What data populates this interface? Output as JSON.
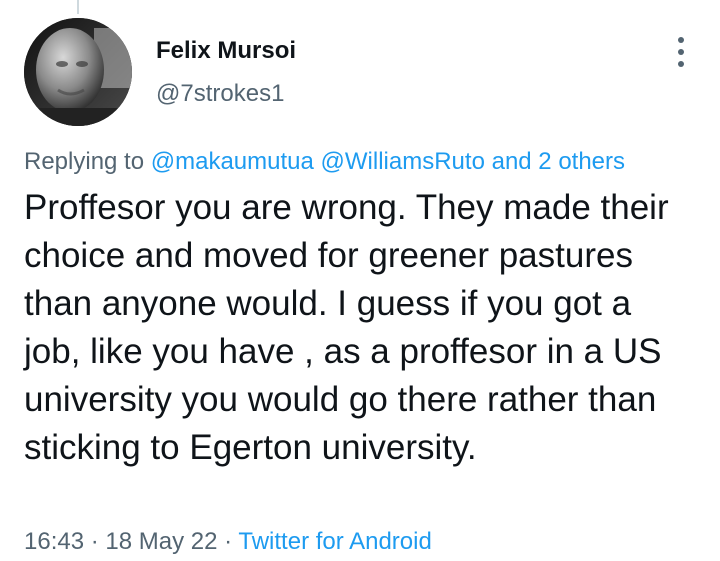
{
  "author": {
    "name": "Felix Mursoi",
    "handle": "@7strokes1"
  },
  "reply_context": {
    "prefix": "Replying to",
    "mention_1": "@makaumutua",
    "mention_2": "@WilliamsRuto",
    "others": "and 2 others"
  },
  "tweet": {
    "text": "Proffesor you are wrong. They made their choice and moved for greener pastures than anyone would. I guess if you got a job, like you have , as a proffesor in a US university you would go there rather than sticking to Egerton university."
  },
  "meta": {
    "time": "16:43",
    "separator": "·",
    "date": "18 May 22",
    "source": "Twitter for Android"
  },
  "icons": {
    "more": "more-vertical-icon"
  },
  "colors": {
    "link": "#1d9bf0",
    "secondary_text": "#536471",
    "primary_text": "#0f1419"
  }
}
